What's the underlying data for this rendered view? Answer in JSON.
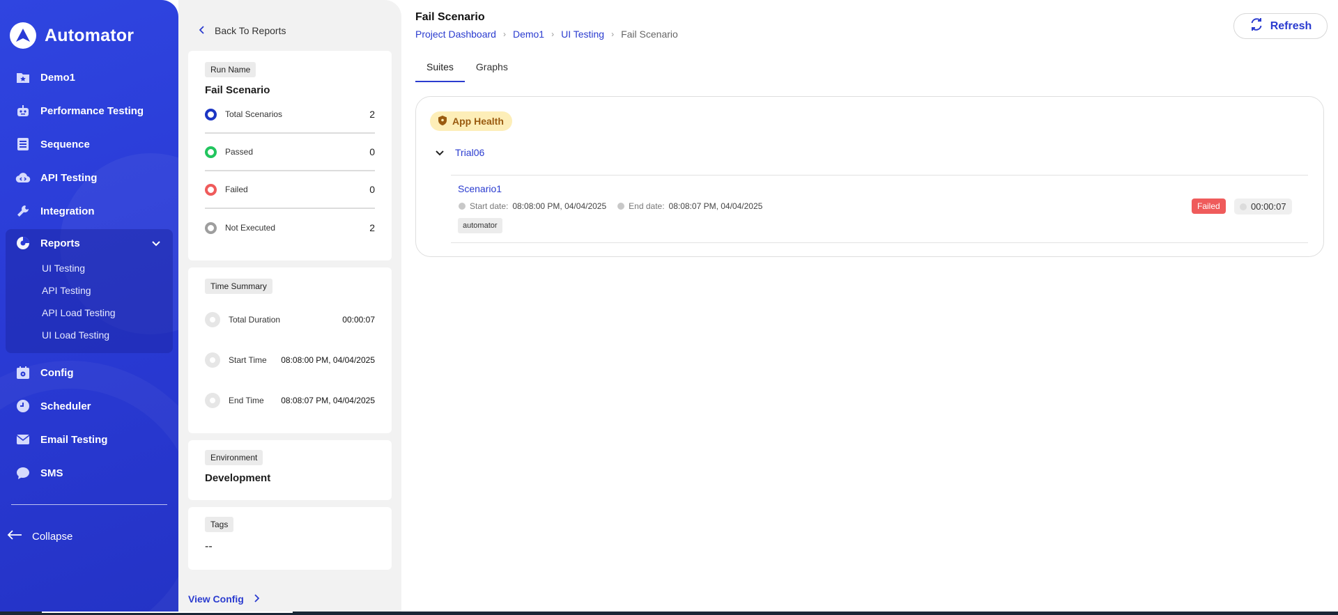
{
  "app": {
    "name": "Automator"
  },
  "sidebar": {
    "items": [
      {
        "label": "Demo1",
        "icon": "star-folder-icon"
      },
      {
        "label": "Performance Testing",
        "icon": "robot-icon"
      },
      {
        "label": "Sequence",
        "icon": "list-icon"
      },
      {
        "label": "API Testing",
        "icon": "cloud-icon"
      },
      {
        "label": "Integration",
        "icon": "wrench-icon"
      }
    ],
    "reports": {
      "label": "Reports",
      "sub_items": [
        "UI Testing",
        "API Testing",
        "API Load Testing",
        "UI Load Testing"
      ]
    },
    "items_after": [
      {
        "label": "Config",
        "icon": "gear-calendar-icon"
      },
      {
        "label": "Scheduler",
        "icon": "clock-icon"
      },
      {
        "label": "Email Testing",
        "icon": "mail-icon"
      },
      {
        "label": "SMS",
        "icon": "chat-icon"
      }
    ],
    "collapse_label": "Collapse"
  },
  "panel": {
    "back_label": "Back To Reports",
    "run_name_chip": "Run Name",
    "run_name": "Fail Scenario",
    "stats": [
      {
        "label": "Total Scenarios",
        "value": "2",
        "color": "#1c36c4"
      },
      {
        "label": "Passed",
        "value": "0",
        "color": "#22c55e"
      },
      {
        "label": "Failed",
        "value": "0",
        "color": "#ef5b5b"
      },
      {
        "label": "Not Executed",
        "value": "2",
        "color": "#9e9e9e"
      }
    ],
    "time_chip": "Time Summary",
    "times": [
      {
        "label": "Total Duration",
        "value": "00:00:07"
      },
      {
        "label": "Start Time",
        "value": "08:08:00 PM, 04/04/2025"
      },
      {
        "label": "End Time",
        "value": "08:08:07 PM, 04/04/2025"
      }
    ],
    "env_chip": "Environment",
    "env_value": "Development",
    "tags_chip": "Tags",
    "tags_value": "--",
    "view_config": "View Config"
  },
  "main": {
    "title": "Fail Scenario",
    "breadcrumb": [
      "Project Dashboard",
      "Demo1",
      "UI Testing",
      "Fail Scenario"
    ],
    "refresh_label": "Refresh",
    "tabs": [
      "Suites",
      "Graphs"
    ],
    "suite": {
      "health_label": "App Health",
      "trial": "Trial06",
      "scenario": {
        "name": "Scenario1",
        "start_label": "Start date:",
        "start_value": "08:08:00 PM, 04/04/2025",
        "end_label": "End date:",
        "end_value": "08:08:07 PM, 04/04/2025",
        "tag": "automator",
        "status": "Failed",
        "duration": "00:00:07"
      }
    }
  }
}
